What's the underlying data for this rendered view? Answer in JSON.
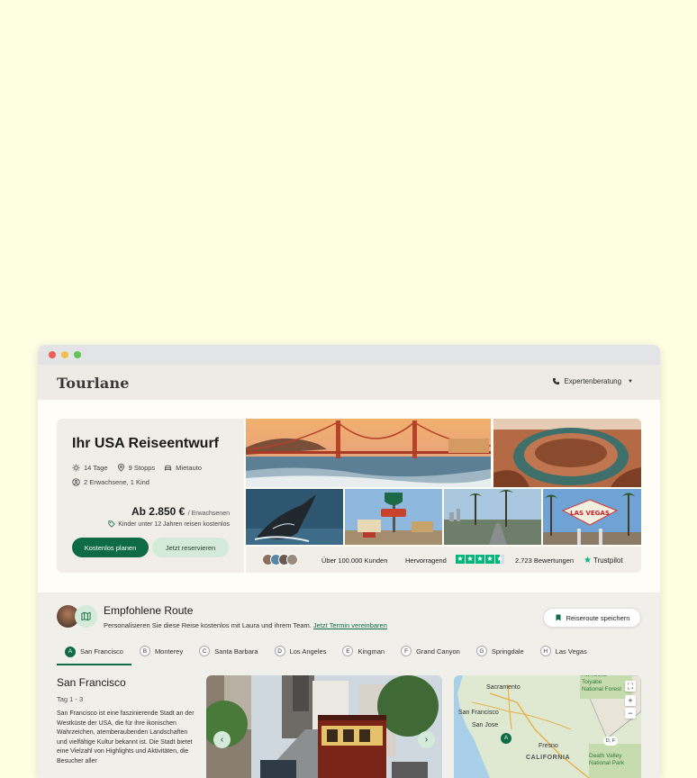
{
  "header": {
    "logo": "Tourlane",
    "expert_label": "Expertenberatung"
  },
  "hero": {
    "title": "Ihr USA Reiseentwurf",
    "facts": {
      "days": "14 Tage",
      "stops": "9 Stopps",
      "car": "Mietauto",
      "travelers": "2 Erwachsene, 1 Kind"
    },
    "price": "Ab 2.850 €",
    "price_unit": "/ Erwachsenen",
    "kids_note": "Kinder unter 12 Jahren reisen kostenlos",
    "primary_button": "Kostenlos planen",
    "secondary_button": "Jetzt reservieren"
  },
  "trust": {
    "customers": "Über 100.000 Kunden",
    "rating_word": "Hervorragend",
    "stars": 4.5,
    "reviews": "2.723 Bewertungen",
    "logo": "Trustpilot"
  },
  "route": {
    "title": "Empfohlene Route",
    "subtitle": "Personalisieren Sie diese Reise kostenlos mit Laura und ihrem Team.",
    "link": "Jetzt Termin vereinbaren",
    "save_button": "Reiseroute speichern",
    "stops": [
      {
        "letter": "A",
        "name": "San Francisco"
      },
      {
        "letter": "B",
        "name": "Monterey"
      },
      {
        "letter": "C",
        "name": "Santa Barbara"
      },
      {
        "letter": "D",
        "name": "Los Angeles"
      },
      {
        "letter": "E",
        "name": "Kingman"
      },
      {
        "letter": "F",
        "name": "Grand Canyon"
      },
      {
        "letter": "G",
        "name": "Springdale"
      },
      {
        "letter": "H",
        "name": "Las Vegas"
      }
    ],
    "city": {
      "name": "San Francisco",
      "days": "Tag 1 - 3",
      "description": "San Francisco ist eine faszinierende Stadt an der Westküste der USA, die für ihre ikonischen Wahrzeichen, atemberaubenden Landschaften und vielfältige Kultur bekannt ist. Die Stadt bietet eine Vielzahl von Highlights und Aktivitäten, die Besucher aller"
    },
    "map": {
      "labels": {
        "sacramento": "Sacramento",
        "san_francisco": "San Francisco",
        "san_jose": "San Jose",
        "fresno": "Fresno",
        "california": "CALIFORNIA",
        "humboldt": "Humboldt-Toiyabe National Forest",
        "death_valley": "Death Valley National Park",
        "pin_a": "A",
        "pin_df": "D, F"
      }
    }
  },
  "colors": {
    "accent": "#0d6b45",
    "accent_light": "#d5ebd9",
    "page_bg": "#fefee3",
    "trustpilot": "#00b67a"
  }
}
